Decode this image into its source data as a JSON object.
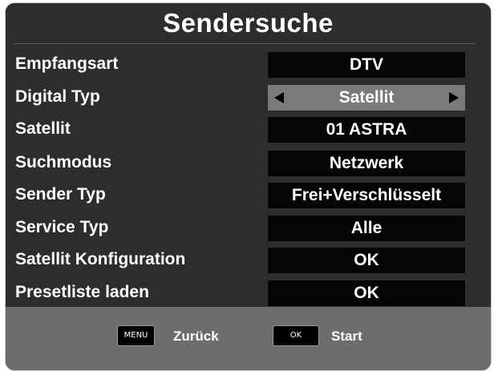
{
  "title": "Sendersuche",
  "rows": [
    {
      "label": "Empfangsart",
      "value": "DTV"
    },
    {
      "label": "Digital Typ",
      "value": "Satellit"
    },
    {
      "label": "Satellit",
      "value": "01 ASTRA"
    },
    {
      "label": "Suchmodus",
      "value": "Netzwerk"
    },
    {
      "label": "Sender Typ",
      "value": "Frei+Verschlüsselt"
    },
    {
      "label": "Service Typ",
      "value": "Alle"
    },
    {
      "label": "Satellit Konfiguration",
      "value": "OK"
    },
    {
      "label": "Presetliste laden",
      "value": "OK"
    }
  ],
  "footer": {
    "menu_key": "MENU",
    "menu_label": "Zurück",
    "ok_key": "OK",
    "ok_label": "Start"
  },
  "colors": {
    "panel": "#2d2d2d",
    "value_box": "#050505",
    "selected_value": "#7a7a7a",
    "footer": "#6d6d6d"
  },
  "icons": [
    "arrow-left-icon",
    "arrow-right-icon"
  ]
}
